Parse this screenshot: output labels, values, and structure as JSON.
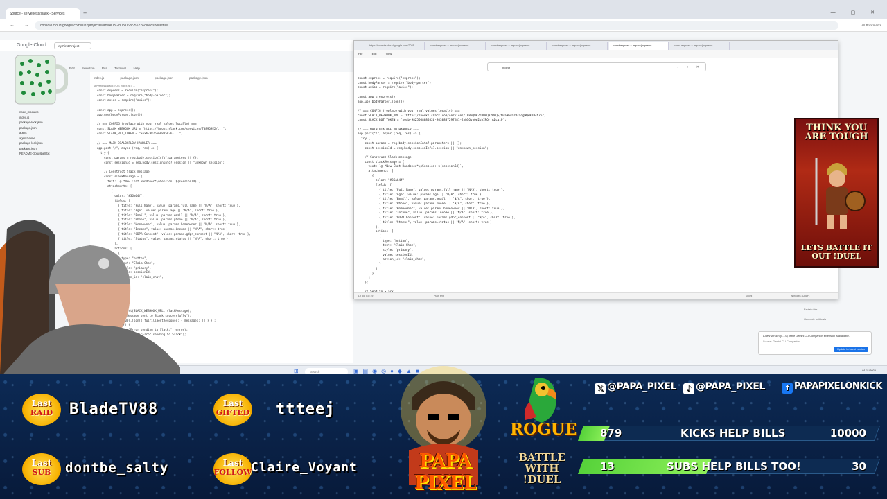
{
  "browser": {
    "tab_title": "Source - serverless/slack - Services",
    "url": "console.cloud.google.com/run?project=waf90e03-2b0b-06dc-5522&cloudshell=true",
    "bookmarks_label": "All Bookmarks"
  },
  "cloud_console": {
    "logo": "Google Cloud",
    "project": "My First Project"
  },
  "ide": {
    "menu": [
      "Edit",
      "Selection",
      "Run",
      "Terminal",
      "Help"
    ],
    "file_tabs": [
      "index.js",
      "package.json",
      "package.json",
      "package.json"
    ],
    "breadcrumb": "serverless/slack > JS index.js > ...",
    "file_tree": [
      "node_modules",
      "index.js",
      "package-lock.json",
      "package.json",
      "agent",
      "agent/Name",
      "package-lock.json",
      "package.json",
      "README-cloudshell.txt"
    ],
    "code": [
      "const express = require(\"express\");",
      "const bodyParser = require(\"body-parser\");",
      "const axios = require(\"axios\");",
      "",
      "const app = express();",
      "app.use(bodyParser.json());",
      "",
      "// === CONFIG (replace with your real values locally) ===",
      "const SLACK_WEBHOOK_URL = \"https://hooks.slack.com/services/T089Q9E2/...\";",
      "const SLACK_BOT_TOKEN = \"xoxb-9825568885826-...\";",
      "",
      "// === MAIN DIALOGFLOW HANDLER ===",
      "app.post(\"/\", async (req, res) => {",
      "  try {",
      "    const params = req.body.sessionInfo?.parameters || {};",
      "    const sessionId = req.body.sessionInfo?.session || \"unknown_session\";",
      "",
      "    // Construct Slack message",
      "    const slackMessage = {",
      "      text: `@ *New Chat Handover*\\nSession: ${sessionId}`,",
      "      attachments: [",
      "        {",
      "          color: \"#36a64f\",",
      "          fields: [",
      "            { title: \"Full Name\", value: params.full_name || \"N/A\", short: true },",
      "            { title: \"Age\", value: params.age || \"N/A\", short: true },",
      "            { title: \"Email\", value: params.email || \"N/A\", short: true },",
      "            { title: \"Phone\", value: params.phone || \"N/A\", short: true },",
      "            { title: \"Homeowner\", value: params.homeowner || \"N/A\", short: true },",
      "            { title: \"Income\", value: params.income || \"N/A\", short: true },",
      "            { title: \"GDPR Consent\", value: params.gdpr_consent || \"N/A\", short: true },",
      "            { title: \"Status\", value: params.status || \"N/A\", short: true }",
      "          ],",
      "          actions: [",
      "            {",
      "              type: \"button\",",
      "              text: \"Claim Chat\",",
      "              style: \"primary\",",
      "              value: sessionId,",
      "              action_id: \"claim_chat\",",
      "            }",
      "          ]",
      "        }",
      "      ]",
      "    };",
      "",
      "    await axios.post(SLACK_WEBHOOK_URL, slackMessage);",
      "    console.log(\"Message sent to Slack successfully\");",
      "    res.status(200).json({ fulfillmentResponse: { messages: [] } });",
      "  } catch (error) {",
      "    console.error(\"Error sending to Slack:\", error);",
      "    res.status(500).send(\"Error sending to Slack\");",
      "  }",
      "});"
    ]
  },
  "notepad": {
    "tabs": [
      "https://console.cloud.google.com/2025",
      "const express = require(express)",
      "const express = require(express)",
      "const express = require(express)",
      "const express = require(express)",
      "const express = require(express)"
    ],
    "menu": [
      "File",
      "Edit",
      "View"
    ],
    "find_text": "project",
    "code": [
      "const express = require(\"express\");",
      "const bodyParser = require(\"body-parser\");",
      "const axios = require(\"axios\");",
      "",
      "const app = express();",
      "app.use(bodyParser.json());",
      "",
      "// === CONFIG (replace with your real values locally) ===",
      "const SLACK_WEBHOOK_URL = \"https://hooks.slack.com/services/T089Q9E2/B09QA2W9QG/NuaNbrCrRsXqgWQeK1B4tZ5\";",
      "const SLACK_BOT_TOKEN = \"xoxb-9825568885826-9838887297281-2nbIOvb0w2sbIRQrrAZcqiP\";",
      "",
      "// === MAIN DIALOGFLOW HANDLER ===",
      "app.post(\"/\", async (req, res) => {",
      "  try {",
      "    const params = req.body.sessionInfo?.parameters || {};",
      "    const sessionId = req.body.sessionInfo?.session || \"unknown_session\";",
      "",
      "    // Construct Slack message",
      "    const slackMessage = {",
      "      text: `@ *New Chat Handover*\\nSession: ${sessionId}`,",
      "      attachments: [",
      "        {",
      "          color: \"#36a64f\",",
      "          fields: [",
      "            { title: \"Full Name\", value: params.full_name || \"N/A\", short: true },",
      "            { title: \"Age\", value: params.age || \"N/A\", short: true },",
      "            { title: \"Email\", value: params.email || \"N/A\", short: true },",
      "            { title: \"Phone\", value: params.phone || \"N/A\", short: true },",
      "            { title: \"Homeowner\", value: params.homeowner || \"N/A\", short: true },",
      "            { title: \"Income\", value: params.income || \"N/A\", short: true },",
      "            { title: \"GDPR Consent\", value: params.gdpr_consent || \"N/A\", short: true },",
      "            { title: \"Status\", value: params.status || \"N/A\", short: true }",
      "          ],",
      "          actions: [",
      "            {",
      "              type: \"button\",",
      "              text: \"Claim Chat\",",
      "              style: \"primary\",",
      "              value: sessionId,",
      "              action_id: \"claim_chat\",",
      "            }",
      "          ]",
      "        }",
      "      ]",
      "    };",
      "",
      "    // Send to Slack"
    ],
    "status_position": "Ln 55, Col 19",
    "status_chars": "2,811 characters",
    "status_text": "Plain text",
    "status_zoom": "100%",
    "status_eol": "Windows (CRLF)",
    "status_enc": "UTF-8"
  },
  "notification": {
    "text": "A new version (0.7.0) of the Gemini CLI Companion extension is available.",
    "source": "Source: Gemini CLI Companion",
    "button": "Update to latest version"
  },
  "side_hints": [
    "Explain this",
    "Generate unit tests"
  ],
  "taskbar": {
    "search": "Search",
    "clock": "01/11/2025"
  },
  "warrior_ad": {
    "top_text": "THINK YOU ARE TOUGH",
    "bottom_text": "LETS BATTLE IT OUT !DUEL"
  },
  "overlay": {
    "last_events": [
      {
        "kind": "RAID",
        "name": "BladeTV88"
      },
      {
        "kind": "GIFTED",
        "name": "ttteej"
      },
      {
        "kind": "SUB",
        "name": "dontbe_salty"
      },
      {
        "kind": "FOLLOW",
        "name": "Claire_Voyant"
      }
    ],
    "brand": "PAPA PIXEL",
    "rogue": "ROGUE",
    "battle": "BATTLE WITH !DUEL",
    "socials": {
      "x": "@PAPA_PIXEL",
      "tiktok": "@PAPA_PIXEL",
      "facebook": "PAPAPIXELONKICK"
    },
    "goals": [
      {
        "count": "879",
        "label": "KICKS HELP BILLS",
        "goal": "10000",
        "progress": 0.0879
      },
      {
        "count": "13",
        "label": "SUBS HELP BILLS TOO!",
        "goal": "30",
        "progress": 0.433
      }
    ],
    "colors": {
      "goal_fill": "#56d23a",
      "brand_orange": "#ff5a00",
      "badge_gold": "#f7b000"
    }
  }
}
